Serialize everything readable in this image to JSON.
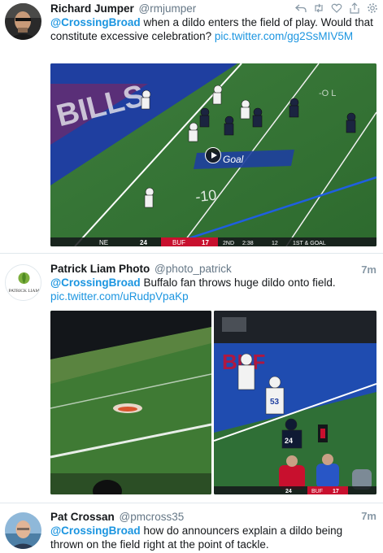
{
  "tweets": [
    {
      "name": "Richard Jumper",
      "handle": "@rmjumper",
      "time": "",
      "mention": "@CrossingBroad",
      "text": " when a dildo enters the field of play. Would that constitute excessive celebration? ",
      "link": "pic.twitter.com/gg2SsMIV5M",
      "media_overlay": {
        "away_team": "NE",
        "away_score": "24",
        "home_team": "BUF",
        "home_score": "17",
        "quarter": "2ND",
        "clock": "2:38",
        "play_clock": "12",
        "down": "1ST & GOAL",
        "field_text": "Goal",
        "yard_marker": "10"
      }
    },
    {
      "name": "Patrick Liam Photo",
      "handle": "@photo_patrick",
      "time": "7m",
      "mention": "@CrossingBroad",
      "text": " Buffalo fan throws huge dildo onto field. ",
      "link": "pic.twitter.com/uRudpVpaKp",
      "avatar_text": "PATRICK LIAM",
      "media_overlay": {
        "jersey_a": "53",
        "jersey_b": "24",
        "away_score": "24",
        "home_team": "BUF",
        "home_score": "17"
      }
    },
    {
      "name": "Pat Crossan",
      "handle": "@pmcross35",
      "time": "7m",
      "mention": "@CrossingBroad",
      "text": " how do announcers explain a dildo being thrown on the field right at the point of tackle."
    }
  ],
  "actions": [
    "reply-icon",
    "retweet-icon",
    "like-icon",
    "share-icon",
    "settings-icon"
  ],
  "colors": {
    "link": "#1b95e0",
    "muted": "#657786",
    "border": "#e1e8ed"
  }
}
